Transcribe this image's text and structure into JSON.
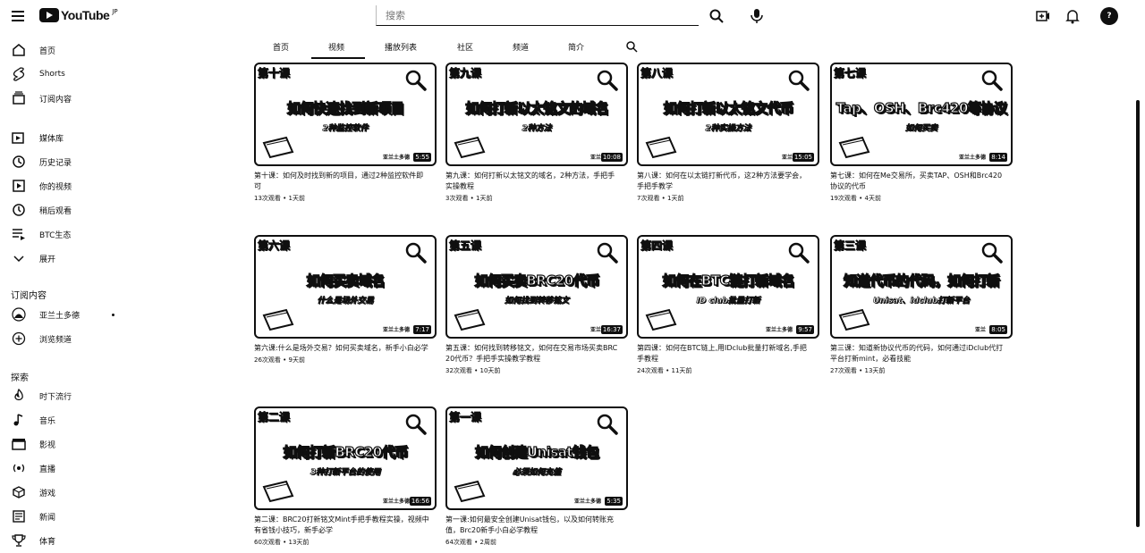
{
  "header": {
    "logo_text": "YouTube",
    "logo_region": "JP",
    "search_placeholder": "搜索",
    "avatar_text": "?"
  },
  "sidebar": {
    "main": [
      {
        "label": "首页",
        "icon": "home-icon"
      },
      {
        "label": "Shorts",
        "icon": "shorts-icon"
      },
      {
        "label": "订阅内容",
        "icon": "subscriptions-icon"
      }
    ],
    "library": [
      {
        "label": "媒体库",
        "icon": "library-icon"
      },
      {
        "label": "历史记录",
        "icon": "history-icon"
      },
      {
        "label": "你的视频",
        "icon": "your-videos-icon"
      },
      {
        "label": "稍后观看",
        "icon": "watch-later-icon"
      },
      {
        "label": "BTC生态",
        "icon": "playlist-icon"
      },
      {
        "label": "展开",
        "icon": "chevron-down-icon"
      }
    ],
    "subscriptions_heading": "订阅内容",
    "subscriptions": [
      {
        "label": "亚兰土多德",
        "icon": "channel-avatar-icon"
      },
      {
        "label": "浏览频道",
        "icon": "add-circle-icon"
      }
    ],
    "explore_heading": "探索",
    "explore": [
      {
        "label": "时下流行",
        "icon": "trending-icon"
      },
      {
        "label": "音乐",
        "icon": "music-icon"
      },
      {
        "label": "影视",
        "icon": "movies-icon"
      },
      {
        "label": "直播",
        "icon": "live-icon"
      },
      {
        "label": "游戏",
        "icon": "gaming-icon"
      },
      {
        "label": "新闻",
        "icon": "news-icon"
      },
      {
        "label": "体育",
        "icon": "sports-icon"
      }
    ]
  },
  "tabs": [
    "首页",
    "视频",
    "播放列表",
    "社区",
    "频道",
    "简介"
  ],
  "active_tab": "视频",
  "videos": [
    {
      "lesson": "第十课",
      "thumb_title": "如何快速找到新项目",
      "thumb_sub": "2种监控软件",
      "author": "亚兰土多德",
      "duration": "5:55",
      "title": "第十课：如何及时找到新的项目，通过2种监控软件即可",
      "meta": "13次观看 • 1天前"
    },
    {
      "lesson": "第九课",
      "thumb_title": "如何打新以太铭文的域名",
      "thumb_sub": "2种方法",
      "author": "亚兰",
      "duration": "10:08",
      "title": "第九课：如何打新以太铭文的域名，2种方法，手把手实操教程",
      "meta": "3次观看 • 1天前"
    },
    {
      "lesson": "第八课",
      "thumb_title": "如何打新以太铭文代币",
      "thumb_sub": "2种实操方法",
      "author": "亚兰",
      "duration": "15:05",
      "title": "第八课：如何在以太链打新代币，这2种方法要学会，手把手教学",
      "meta": "7次观看 • 1天前"
    },
    {
      "lesson": "第七课",
      "thumb_title": "Tap、OSH、Brc420等协议",
      "thumb_sub": "如何买卖",
      "author": "亚兰土多德",
      "duration": "8:14",
      "title": "第七课：如何在Me交易所，买卖TAP、OSH和Brc420协议的代币",
      "meta": "19次观看 • 4天前"
    },
    {
      "lesson": "第六课",
      "thumb_title": "如何买卖域名",
      "thumb_sub": "什么是场外交易",
      "author": "亚兰土多德",
      "duration": "7:17",
      "title": "第六课:什么是场外交易？如何买卖域名，新手小白必学",
      "meta": "26次观看 • 9天前"
    },
    {
      "lesson": "第五课",
      "thumb_title": "如何买卖BRC20代币",
      "thumb_sub": "如何找到转移铭文",
      "author": "亚兰",
      "duration": "16:37",
      "title": "第五课：如何找到转移铭文，如何在交易市场买卖BRC20代币？手把手实操教学教程",
      "meta": "32次观看 • 10天前"
    },
    {
      "lesson": "第四课",
      "thumb_title": "如何在BTC链打新域名",
      "thumb_sub": "ID club批量打新",
      "author": "亚兰土多德",
      "duration": "9:57",
      "title": "第四课：如何在BTC链上,用IDclub批量打新域名,手把手教程",
      "meta": "24次观看 • 11天前"
    },
    {
      "lesson": "第三课",
      "thumb_title": "知道代币的代码，如何打新",
      "thumb_sub": "Unisat、idclub打新平台",
      "author": "亚兰",
      "duration": "8:05",
      "title": "第三课：知道新协议代币的代码，如何通过iDclub代打平台打新mint，必看技能",
      "meta": "27次观看 • 13天前"
    },
    {
      "lesson": "第二课",
      "thumb_title": "如何打新BRC20代币",
      "thumb_sub": "3种打新平台的使用",
      "author": "亚兰土多德",
      "duration": "16:56",
      "title": "第二课：BRC20打新铭文Mint手把手教程实操，视频中有省钱小技巧，新手必学",
      "meta": "60次观看 • 13天前"
    },
    {
      "lesson": "第一课",
      "thumb_title": "如何创建Unisat钱包",
      "thumb_sub": "必须如何充值",
      "author": "亚兰土多德",
      "duration": "5:35",
      "title": "第一课:如何最安全创建Unisat钱包，以及如何转账充值，Brc20新手小白必学教程",
      "meta": "64次观看 • 2周前"
    }
  ]
}
